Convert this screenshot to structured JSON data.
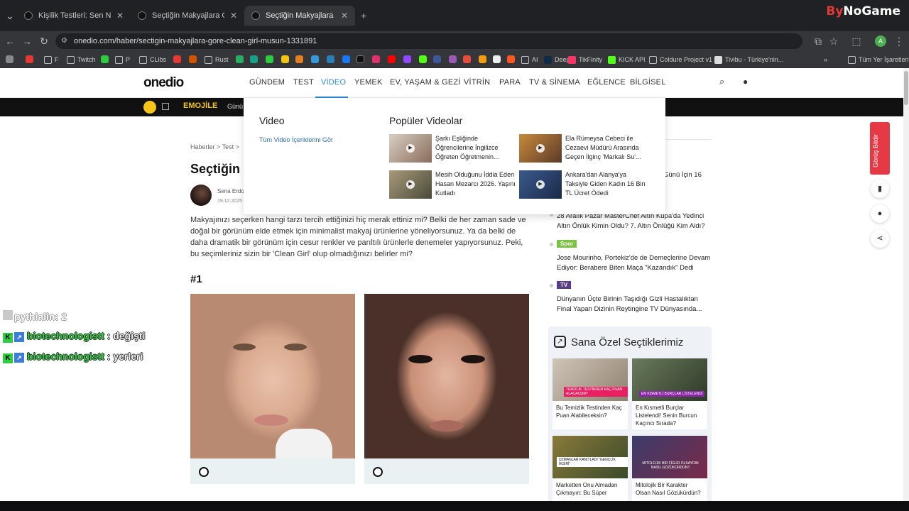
{
  "browser": {
    "tabs": [
      {
        "label": "Kişilik Testleri: Sen Nasıl Birisin?"
      },
      {
        "label": "Seçtiğin Makyajlara Göre Clean..."
      },
      {
        "label": "Seçtiğin Makyajlara Göre Clean..."
      }
    ],
    "new_tab": "+",
    "url": "onedio.com/haber/sectigin-makyajlara-gore-clean-girl-musun-1331891",
    "bookmarks": [
      "F",
      "Twitch",
      "P",
      "CLibs",
      "Rust",
      "AI",
      "DeepL",
      "TikFinity",
      "KICK API",
      "Coldure Project v1",
      "Tivibu - Türkiye'nin...",
      "Tüm Yer İşaretleri"
    ],
    "stream_brand": {
      "a": "By",
      "b": "NoGame"
    }
  },
  "site": {
    "logo": "onedio",
    "nav": [
      "GÜNDEM",
      "TEST",
      "VİDEO",
      "YEMEK",
      "EV, YAŞAM & GEZİ",
      "VİTRİN",
      "PARA",
      "TV & SİNEMA",
      "EĞLENCE",
      "BİLGİSEL"
    ],
    "active_nav": "VİDEO",
    "promo": {
      "emoji": "EMOJİLE",
      "text": "Günü"
    }
  },
  "dropdown": {
    "heading": "Video",
    "all_link": "Tüm Video İçeriklerini Gör",
    "popular_heading": "Popüler Videolar",
    "videos": [
      {
        "title": "Şarkı Eşliğinde Öğrencilerine İngilizce Öğreten Öğretmenin..."
      },
      {
        "title": "Ela Rümeysa Cebeci ile Cezaevi Müdürü Arasında Geçen İlginç 'Markalı Su'..."
      },
      {
        "title": "Mesih Olduğunu İddia Eden Hasan Mezarcı 2026. Yaşını Kutladı"
      },
      {
        "title": "Ankara'dan Alanya'ya Taksiyle Giden Kadın 16 Bin TL Ücret Ödedi"
      }
    ]
  },
  "article": {
    "breadcrumb": "Haberler > Test > ",
    "title": "Seçtiğin ",
    "author": "Sena Erdo",
    "date": "19.12.2025",
    "intro": "Makyajınızı seçerken hangi tarzı tercih ettiğinizi hiç merak ettiniz mi? Belki de her zaman sade ve doğal bir görünüm elde etmek için minimalist makyaj ürünlerine yöneliyorsunuz. Ya da belki de daha dramatik bir görünüm için cesur renkler ve parıltılı ürünlerle denemeler yapıyorsunuz. Peki, bu seçimleriniz sizin bir 'Clean Girl' olup olmadığınızı belirler mi?",
    "question": "#1"
  },
  "sidebar": {
    "items": [
      {
        "text": "Günü İçin 16"
      },
      {
        "text": "28 Aralık Pazar MasterChef Altın Kupa'da Yedinci Altın Önlük Kimin Oldu? 7. Altın Önlüğü Kim Aldı?"
      },
      {
        "badge": "Spor",
        "text": "Jose Mourinho, Portekiz'de de Demeçlerine Devam Ediyor: Berabere Biten Maça \"Kazandık\" Dedi"
      },
      {
        "badge": "TV",
        "text": "Dünyanın Üçte Birinin Taşıdığı Gizli Hastalıktan Final Yapan Dizinin Reytingine TV Dünyasında..."
      }
    ],
    "badge_colors": {
      "Spor": "#7cc242",
      "TV": "#5a3d8a"
    },
    "ozel_title": "Sana Özel Seçtiklerimiz",
    "cards": [
      {
        "title": "Bu Temizlik Testinden Kaç Puan Alabileceksin?",
        "img_text": "TEMİZLİK TESTİNDEN KAÇ PUAN ALACAKSIN?"
      },
      {
        "title": "En Kısmetli Burçlar Listelendi! Senin Burcun Kaçıncı Sırada?",
        "img_text": "EN KISMETLİ BURÇLAR LİSTELENDİ"
      },
      {
        "title": "Marketten Onu Almadan Çıkmayın: Bu Süper",
        "img_text": "UZMANLAR KANITLADI \"GENÇLİK İKSİRİ\""
      },
      {
        "title": "Mitolojik Bir Karakter Olsan Nasıl Gözükürdün?",
        "img_text": "MİTOLOJİK BİR FİGÜR OLSAYDIN NASIL GÖZÜKÜRDÜN?"
      }
    ]
  },
  "feedback": {
    "label": "Görüş Bildir"
  },
  "chat": [
    {
      "user": "pythialin",
      "msg": ": 2"
    },
    {
      "user": "biotechnologistt",
      "msg": " : değişti"
    },
    {
      "user": "biotechnologistt",
      "msg": " : yerleri"
    }
  ],
  "colors": {
    "accent": "#2f86d9",
    "feedback": "#e53945",
    "chat_user": "#2ecc40"
  }
}
